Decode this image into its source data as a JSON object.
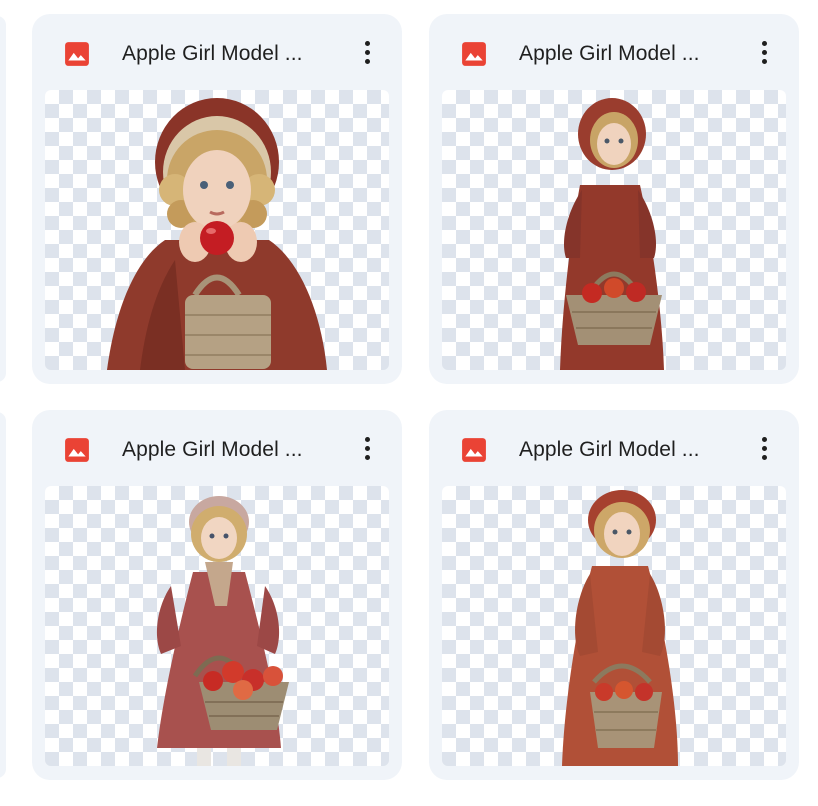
{
  "files": [
    {
      "title": "Apple Girl Model ...",
      "icon": "image-file-icon",
      "menu_icon": "more-vert-icon"
    },
    {
      "title": "Apple Girl Model ...",
      "icon": "image-file-icon",
      "menu_icon": "more-vert-icon"
    },
    {
      "title": "Apple Girl Model ...",
      "icon": "image-file-icon",
      "menu_icon": "more-vert-icon"
    },
    {
      "title": "Apple Girl Model ...",
      "icon": "image-file-icon",
      "menu_icon": "more-vert-icon"
    }
  ],
  "colors": {
    "card_background": "#f0f4f9",
    "image_icon": "#ea4335",
    "checker": "#dde3ec",
    "dress_red": "#8f3a2c",
    "title_text": "#1f1f1f"
  }
}
